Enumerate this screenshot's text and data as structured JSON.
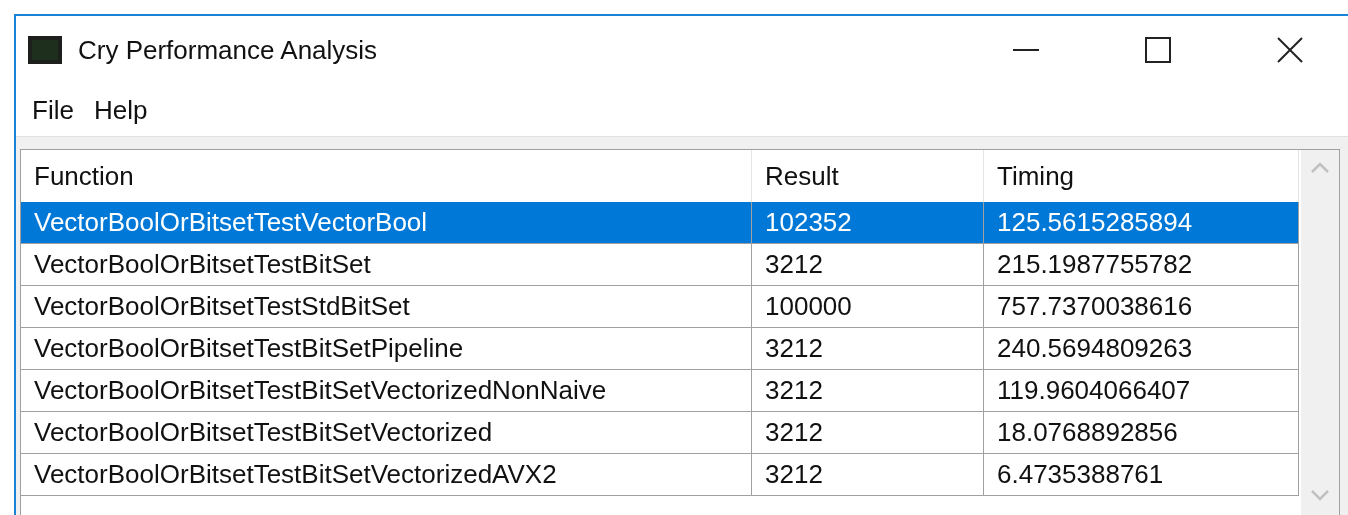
{
  "window": {
    "title": "Cry Performance Analysis"
  },
  "menu": [
    {
      "label": "File"
    },
    {
      "label": "Help"
    }
  ],
  "table": {
    "columns": [
      "Function",
      "Result",
      "Timing"
    ],
    "rows": [
      {
        "cells": [
          "VectorBoolOrBitsetTestVectorBool",
          "102352",
          "125.5615285894"
        ],
        "selected": true
      },
      {
        "cells": [
          "VectorBoolOrBitsetTestBitSet",
          "3212",
          "215.1987755782"
        ],
        "selected": false
      },
      {
        "cells": [
          "VectorBoolOrBitsetTestStdBitSet",
          "100000",
          "757.7370038616"
        ],
        "selected": false
      },
      {
        "cells": [
          "VectorBoolOrBitsetTestBitSetPipeline",
          "3212",
          "240.5694809263"
        ],
        "selected": false
      },
      {
        "cells": [
          "VectorBoolOrBitsetTestBitSetVectorizedNonNaive",
          "3212",
          "119.9604066407"
        ],
        "selected": false
      },
      {
        "cells": [
          "VectorBoolOrBitsetTestBitSetVectorized",
          "3212",
          "18.0768892856"
        ],
        "selected": false
      },
      {
        "cells": [
          "VectorBoolOrBitsetTestBitSetVectorizedAVX2",
          "3212",
          "6.4735388761"
        ],
        "selected": false
      }
    ]
  }
}
